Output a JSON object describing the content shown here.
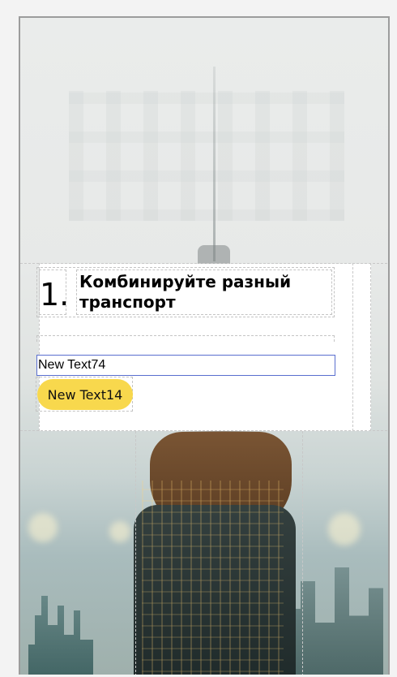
{
  "step": {
    "number": "1.",
    "heading": "Комбинируйте разный транспорт"
  },
  "text_field": {
    "value": "New Text74"
  },
  "pill": {
    "label": "New Text14",
    "color": "#f8d84d"
  },
  "colors": {
    "input_border": "#5a6fcf",
    "frame_border": "#9c9c9c",
    "guide": "#c8c8c8"
  }
}
